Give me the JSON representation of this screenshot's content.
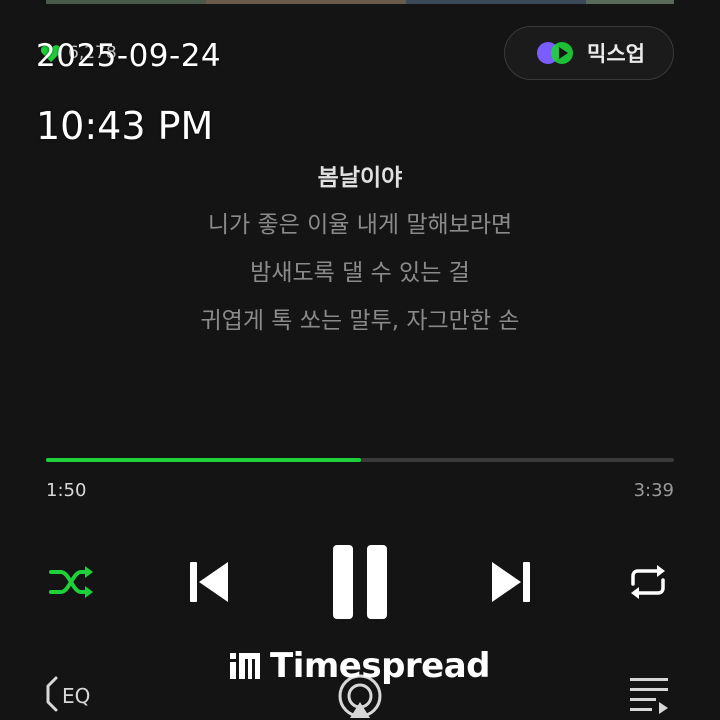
{
  "header": {
    "like_count": "6,278",
    "mixup_label": "믹스업"
  },
  "overlay": {
    "date": "2025-09-24",
    "time": "10:43 PM"
  },
  "lyrics": {
    "current": "봄날이야",
    "lines": [
      "니가 좋은 이율 내게 말해보라면",
      "밤새도록 댈 수 있는 걸",
      "귀엽게 톡 쏘는 말투, 자그만한 손"
    ]
  },
  "player": {
    "elapsed": "1:50",
    "total": "3:39",
    "progress": 0.502,
    "accent_color": "#1ed13a"
  },
  "controls": {
    "shuffle_icon": "shuffle-icon",
    "prev_icon": "skip-previous-icon",
    "play_pause_icon": "pause-icon",
    "next_icon": "skip-next-icon",
    "repeat_icon": "repeat-icon",
    "eq_label": "EQ",
    "cast_icon": "airplay-icon",
    "playlist_icon": "playlist-icon"
  },
  "watermark": {
    "text": "Timespread"
  }
}
